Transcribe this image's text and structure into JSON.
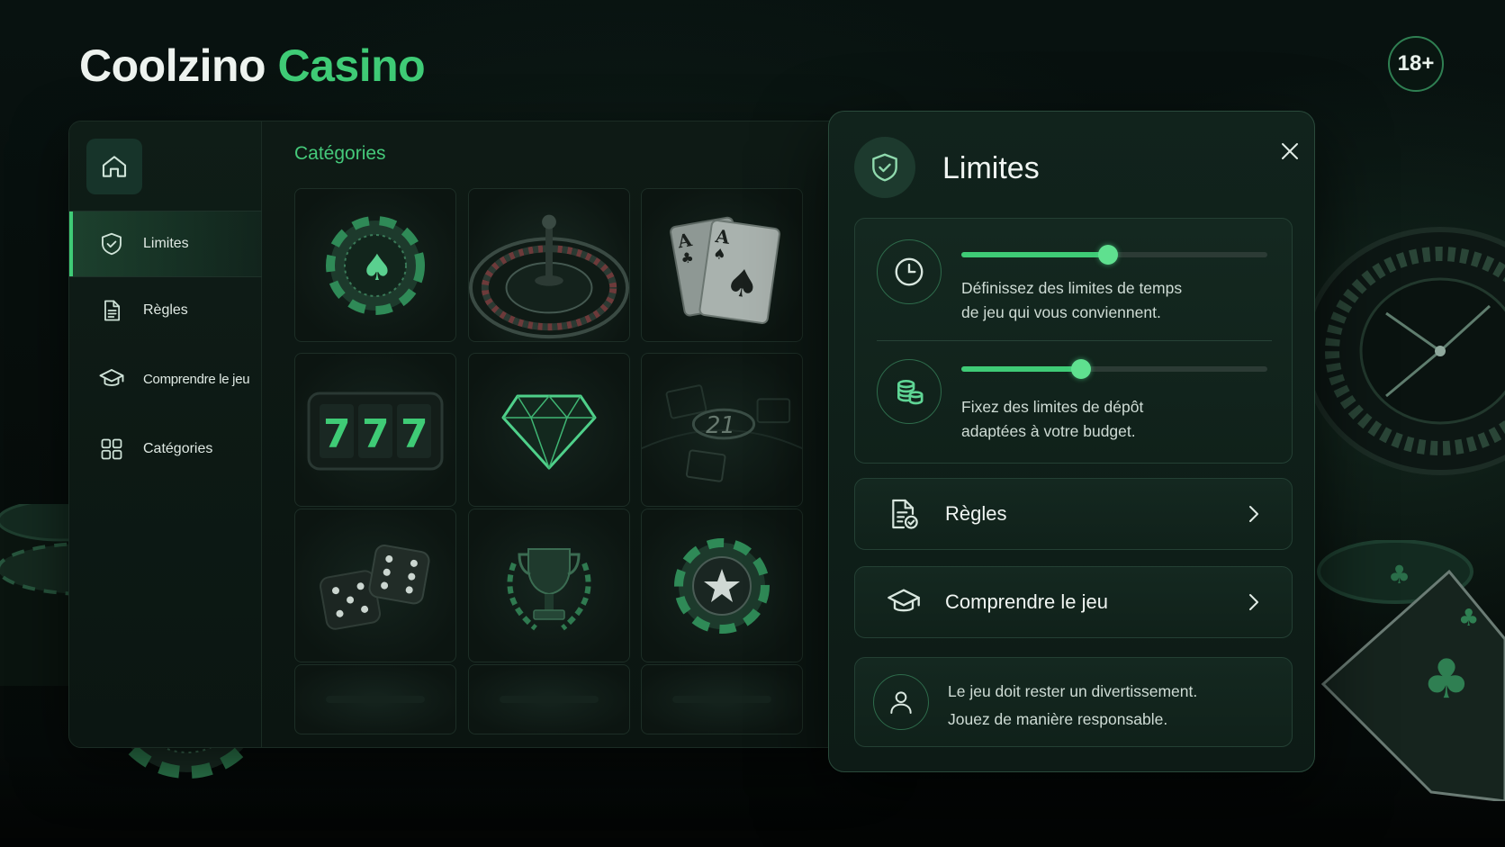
{
  "brand": {
    "name_part1": "Coolzino",
    "name_part2": "Casino"
  },
  "age_badge": "18+",
  "sidebar": {
    "items": [
      {
        "label": "Limites",
        "icon": "shield-check-icon",
        "active": true
      },
      {
        "label": "Règles",
        "icon": "document-icon",
        "active": false
      },
      {
        "label": "Comprendre le jeu",
        "icon": "graduation-cap-icon",
        "active": false
      },
      {
        "label": "Catégories",
        "icon": "grid-icon",
        "active": false
      }
    ]
  },
  "categories": {
    "title": "Catégories",
    "tiles": [
      {
        "icon": "poker-chip-spade-icon"
      },
      {
        "icon": "roulette-wheel-icon"
      },
      {
        "icon": "playing-cards-icon"
      },
      {
        "icon": "slot-machine-icon",
        "text": "777"
      },
      {
        "icon": "diamond-icon"
      },
      {
        "icon": "blackjack-table-icon",
        "text": "21"
      },
      {
        "icon": "dice-icon"
      },
      {
        "icon": "trophy-icon"
      },
      {
        "icon": "poker-chip-star-icon"
      }
    ]
  },
  "limits_panel": {
    "title": "Limites",
    "time_limit": {
      "text_line1": "Définissez des limites de temps",
      "text_line2": "de jeu qui vous conviennent.",
      "slider_value": 0.48
    },
    "deposit_limit": {
      "text_line1": "Fixez des limites de dépôt",
      "text_line2": "adaptées à votre budget.",
      "slider_value": 0.39
    },
    "links": [
      {
        "label": "Règles",
        "icon": "document-check-icon"
      },
      {
        "label": "Comprendre le jeu",
        "icon": "graduation-cap-icon"
      }
    ],
    "note": {
      "line1": "Le jeu doit rester un divertissement.",
      "line2": "Jouez de manière responsable."
    }
  },
  "colors": {
    "accent": "#3fcb76",
    "background": "#070e0c",
    "panel": "#0e1a15",
    "card": "#142820"
  }
}
